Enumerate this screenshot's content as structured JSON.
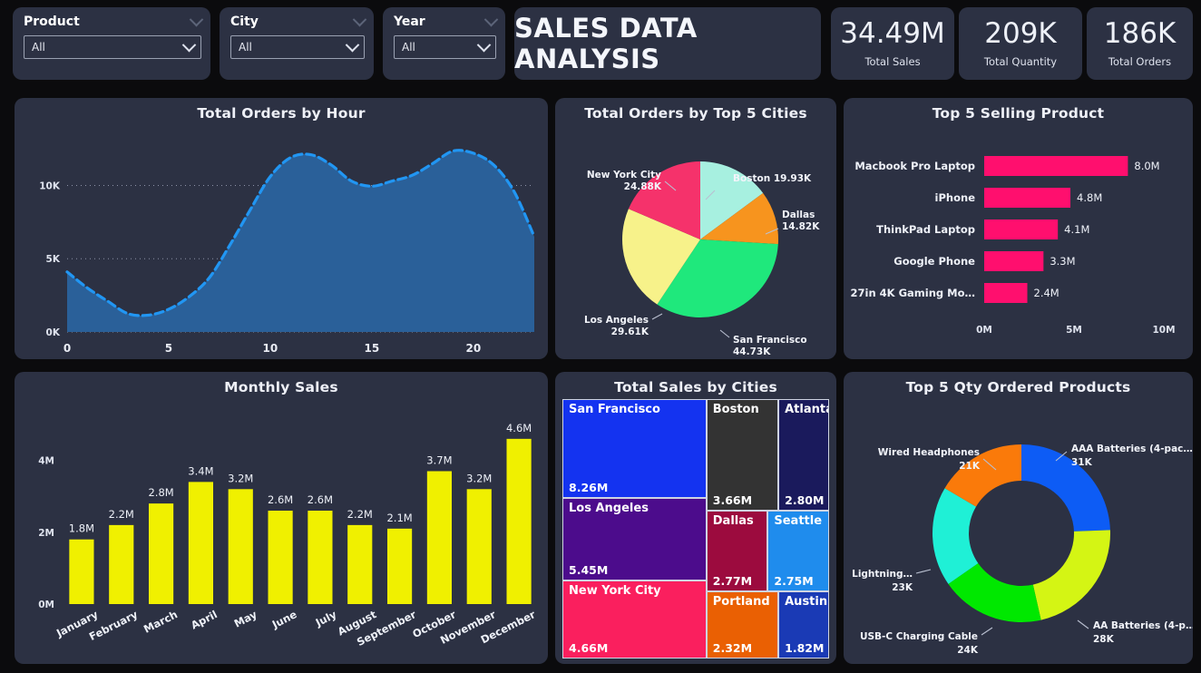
{
  "slicers": [
    {
      "name": "Product",
      "value": "All"
    },
    {
      "name": "City",
      "value": "All"
    },
    {
      "name": "Year",
      "value": "All"
    }
  ],
  "header": {
    "title": "SALES DATA ANALYSIS"
  },
  "kpis": [
    {
      "value": "34.49M",
      "label": "Total Sales"
    },
    {
      "value": "209K",
      "label": "Total Quantity"
    },
    {
      "value": "186K",
      "label": "Total Orders"
    }
  ],
  "chart_data": [
    {
      "id": "orders_by_hour",
      "type": "area",
      "title": "Total Orders by Hour",
      "xlabel": "",
      "ylabel": "",
      "xticks": [
        0,
        5,
        10,
        15,
        20
      ],
      "xtick_labels": [
        "0",
        "5",
        "10",
        "15",
        "20"
      ],
      "yticks": [
        0,
        5000,
        10000
      ],
      "ytick_labels": [
        "0K",
        "5K",
        "10K"
      ],
      "xlim": [
        0,
        23
      ],
      "ylim": [
        0,
        13000
      ],
      "grid": true,
      "legend": "none",
      "line_color": "#2196f3",
      "fill_color": "#2a6099",
      "line_style": "dashed",
      "x": [
        0,
        1,
        2,
        3,
        4,
        5,
        6,
        7,
        8,
        9,
        10,
        11,
        12,
        13,
        14,
        15,
        16,
        17,
        18,
        19,
        20,
        21,
        22,
        23
      ],
      "values": [
        4100,
        3000,
        2100,
        1250,
        1150,
        1550,
        2400,
        3700,
        5900,
        8300,
        10600,
        11900,
        12100,
        11400,
        10300,
        9950,
        10300,
        10700,
        11500,
        12350,
        12200,
        11400,
        9600,
        6500
      ]
    },
    {
      "id": "orders_top5_cities",
      "type": "pie",
      "title": "Total Orders by Top 5 Cities",
      "labels": [
        "Boston",
        "Dallas",
        "San Francisco",
        "Los Angeles",
        "New York City"
      ],
      "value_labels": [
        "19.93K",
        "14.82K",
        "44.73K",
        "29.61K",
        "24.88K"
      ],
      "values": [
        19.93,
        14.82,
        44.73,
        29.61,
        24.88
      ],
      "colors": [
        "#a7f0e0",
        "#f7941e",
        "#1fe87c",
        "#f7f28a",
        "#f5326b"
      ],
      "legend": "labels-outside"
    },
    {
      "id": "top5_selling_product",
      "type": "bar",
      "orientation": "horizontal",
      "title": "Top 5 Selling Product",
      "categories": [
        "Macbook Pro Laptop",
        "iPhone",
        "ThinkPad Laptop",
        "Google Phone",
        "27in 4K Gaming Mo…"
      ],
      "values": [
        8.0,
        4.8,
        4.1,
        3.3,
        2.4
      ],
      "data_labels": [
        "8.0M",
        "4.8M",
        "4.1M",
        "3.3M",
        "2.4M"
      ],
      "xticks": [
        0,
        5,
        10
      ],
      "xtick_labels": [
        "0M",
        "5M",
        "10M"
      ],
      "xlim": [
        0,
        10
      ],
      "bar_color": "#ff0f6e",
      "grid": false
    },
    {
      "id": "monthly_sales",
      "type": "bar",
      "orientation": "vertical",
      "title": "Monthly Sales",
      "categories": [
        "January",
        "February",
        "March",
        "April",
        "May",
        "June",
        "July",
        "August",
        "September",
        "October",
        "November",
        "December"
      ],
      "values": [
        1.8,
        2.2,
        2.8,
        3.4,
        3.2,
        2.6,
        2.6,
        2.2,
        2.1,
        3.7,
        3.2,
        4.6
      ],
      "data_labels": [
        "1.8M",
        "2.2M",
        "2.8M",
        "3.4M",
        "3.2M",
        "2.6M",
        "2.6M",
        "2.2M",
        "2.1M",
        "3.7M",
        "3.2M",
        "4.6M"
      ],
      "yticks": [
        0,
        2,
        4
      ],
      "ytick_labels": [
        "0M",
        "2M",
        "4M"
      ],
      "ylim": [
        0,
        5.0
      ],
      "bar_color": "#f0f000",
      "grid": false
    },
    {
      "id": "total_sales_by_cities",
      "type": "treemap",
      "title": "Total Sales by Cities",
      "tiles": [
        {
          "name": "San Francisco",
          "value_label": "8.26M",
          "value": 8.26,
          "color": "#1433f0"
        },
        {
          "name": "Los Angeles",
          "value_label": "5.45M",
          "value": 5.45,
          "color": "#4c0c8c"
        },
        {
          "name": "New York City",
          "value_label": "4.66M",
          "value": 4.66,
          "color": "#fa1f5e"
        },
        {
          "name": "Boston",
          "value_label": "3.66M",
          "value": 3.66,
          "color": "#333333"
        },
        {
          "name": "Atlanta",
          "value_label": "2.80M",
          "value": 2.8,
          "color": "#1a1a5c"
        },
        {
          "name": "Dallas",
          "value_label": "2.77M",
          "value": 2.77,
          "color": "#9c0b3e"
        },
        {
          "name": "Seattle",
          "value_label": "2.75M",
          "value": 2.75,
          "color": "#1f8ced"
        },
        {
          "name": "Portland",
          "value_label": "2.32M",
          "value": 2.32,
          "color": "#ea6003"
        },
        {
          "name": "Austin",
          "value_label": "1.82M",
          "value": 1.82,
          "color": "#1a3ab5"
        }
      ]
    },
    {
      "id": "top5_qty_ordered",
      "type": "pie",
      "subtype": "donut",
      "title": "Top 5 Qty Ordered Products",
      "labels": [
        "AAA Batteries (4-pac…",
        "AA Batteries (4-p…",
        "USB-C Charging Cable",
        "Lightning…",
        "Wired Headphones"
      ],
      "value_labels": [
        "31K",
        "28K",
        "24K",
        "23K",
        "21K"
      ],
      "values": [
        31,
        28,
        24,
        23,
        21
      ],
      "colors": [
        "#0d5cf5",
        "#d4f514",
        "#00e800",
        "#1ff0d6",
        "#fa7a0a"
      ],
      "legend": "labels-outside"
    }
  ]
}
